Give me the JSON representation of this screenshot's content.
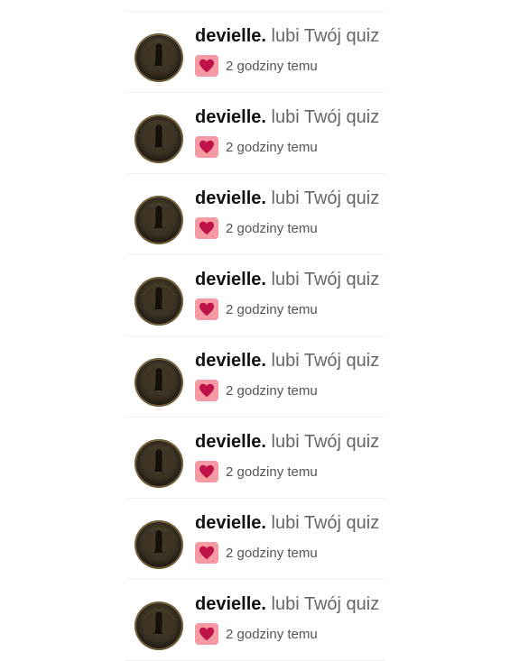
{
  "notifications": [
    {
      "user": "devielle.",
      "action": "lubi Twój quiz",
      "time": "2 godziny temu",
      "icon": "heart-icon"
    },
    {
      "user": "devielle.",
      "action": "lubi Twój quiz",
      "time": "2 godziny temu",
      "icon": "heart-icon"
    },
    {
      "user": "devielle.",
      "action": "lubi Twój quiz",
      "time": "2 godziny temu",
      "icon": "heart-icon"
    },
    {
      "user": "devielle.",
      "action": "lubi Twój quiz",
      "time": "2 godziny temu",
      "icon": "heart-icon"
    },
    {
      "user": "devielle.",
      "action": "lubi Twój quiz",
      "time": "2 godziny temu",
      "icon": "heart-icon"
    },
    {
      "user": "devielle.",
      "action": "lubi Twój quiz",
      "time": "2 godziny temu",
      "icon": "heart-icon"
    },
    {
      "user": "devielle.",
      "action": "lubi Twój quiz",
      "time": "2 godziny temu",
      "icon": "heart-icon"
    },
    {
      "user": "devielle.",
      "action": "lubi Twój quiz",
      "time": "2 godziny temu",
      "icon": "heart-icon"
    }
  ],
  "colors": {
    "heart": "#c0124a",
    "heart_badge_bg": "#f59aa3",
    "username": "#111111",
    "action_text": "#666666",
    "time_text": "#555555",
    "divider": "#f0f0f0"
  }
}
